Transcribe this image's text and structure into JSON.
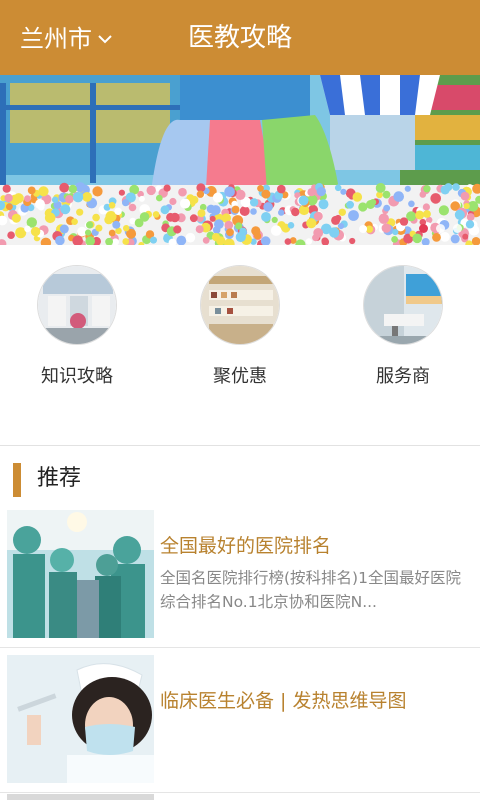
{
  "header": {
    "city": "兰州市",
    "title": "医教攻略"
  },
  "banner": {
    "dot_count": 3,
    "active_dot": 0,
    "accent_color": "#e23b54"
  },
  "categories": [
    {
      "label": "知识攻略",
      "icon": "knowledge-photo"
    },
    {
      "label": "聚优惠",
      "icon": "discount-photo"
    },
    {
      "label": "服务商",
      "icon": "provider-photo"
    }
  ],
  "recommend": {
    "section_title": "推荐",
    "articles": [
      {
        "title": "全国最好的医院排名",
        "desc": "全国名医院排行榜(按科排名)1全国最好医院综合排名No.1北京协和医院N..."
      },
      {
        "title": "临床医生必备 | 发热思维导图",
        "desc": ""
      }
    ]
  },
  "colors": {
    "brand": "#cc8c34",
    "title_text": "#b8822f"
  }
}
